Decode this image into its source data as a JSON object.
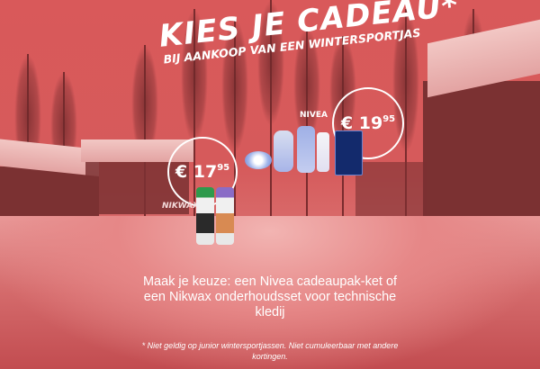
{
  "headline": "KIES JE CADEAU*",
  "subheadline": "BIJ AANKOOP VAN EEN WINTERSPORTJAS",
  "offers": [
    {
      "brand": "NIKWAX",
      "price_currency": "€",
      "price_main": "17",
      "price_cents": "95"
    },
    {
      "brand": "NIVEA",
      "price_currency": "€",
      "price_main": "19",
      "price_cents": "95"
    }
  ],
  "description": "Maak je keuze: een Nivea cadeaupak-ket of een Nikwax onderhoudsset voor technische kledij",
  "footnote": "* Niet geldig op junior wintersportjassen. Niet cumuleerbaar met andere kortingen.",
  "colors": {
    "overlay": "#d65a5b",
    "text": "#ffffff"
  }
}
